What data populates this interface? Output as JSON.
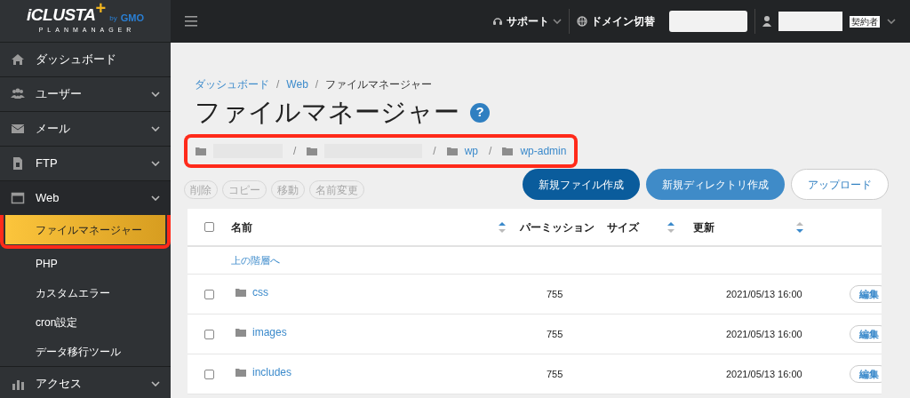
{
  "logo": {
    "brand": "iCLUSTA",
    "plus": "+",
    "by": "by",
    "maker": "GMO",
    "product": "PLANMANAGER"
  },
  "sidebar": {
    "items": [
      {
        "label": "ダッシュボード",
        "expandable": false,
        "highlighted": false
      },
      {
        "label": "ユーザー",
        "expandable": true,
        "highlighted": false
      },
      {
        "label": "メール",
        "expandable": true,
        "highlighted": false
      },
      {
        "label": "FTP",
        "expandable": true,
        "highlighted": false
      },
      {
        "label": "Web",
        "expandable": true,
        "expanded": true,
        "highlighted": true,
        "children": [
          {
            "label": "ファイルマネージャー",
            "selected": true
          },
          {
            "label": "PHP",
            "selected": false
          },
          {
            "label": "カスタムエラー",
            "selected": false
          },
          {
            "label": "cron設定",
            "selected": false
          },
          {
            "label": "データ移行ツール",
            "selected": false
          }
        ]
      },
      {
        "label": "アクセス",
        "expandable": true,
        "highlighted": false
      }
    ]
  },
  "top_bar": {
    "support": "サポート",
    "domain_switch": "ドメイン切替",
    "role_badge": "契約者"
  },
  "breadcrumb": {
    "separator": "/",
    "items": [
      {
        "label": "ダッシュボード",
        "link": true
      },
      {
        "label": "Web",
        "link": true
      },
      {
        "label": "ファイルマネージャー",
        "link": false
      }
    ]
  },
  "title": "ファイルマネージャー",
  "help_mark": "?",
  "path_bar": {
    "highlighted": true,
    "separator": "/",
    "segments": [
      {
        "kind": "redacted"
      },
      {
        "kind": "redacted"
      },
      {
        "kind": "folder",
        "label": "wp"
      },
      {
        "kind": "folder",
        "label": "wp-admin"
      }
    ]
  },
  "bulk_actions": [
    {
      "label": "削除",
      "disabled": true
    },
    {
      "label": "コピー",
      "disabled": true
    },
    {
      "label": "移動",
      "disabled": true
    },
    {
      "label": "名前変更",
      "disabled": true
    }
  ],
  "create_buttons": [
    {
      "label": "新規ファイル作成",
      "kind": "dark"
    },
    {
      "label": "新規ディレクトリ作成",
      "kind": "light"
    },
    {
      "label": "アップロード",
      "kind": "outline"
    }
  ],
  "table": {
    "columns": [
      {
        "label": "名前",
        "sortable": true,
        "sort_ascending": true
      },
      {
        "label": "パーミッション",
        "sortable": false
      },
      {
        "label": "サイズ",
        "sortable": true,
        "sort_ascending": true
      },
      {
        "label": "更新",
        "sortable": true,
        "sort_ascending": false
      }
    ],
    "all_checked": false,
    "parent_link": "上の階層へ",
    "rows": [
      {
        "name": "css",
        "permission": "755",
        "updated": "2021/05/13 16:00",
        "action": "編集",
        "checked": false
      },
      {
        "name": "images",
        "permission": "755",
        "updated": "2021/05/13 16:00",
        "action": "編集",
        "checked": false
      },
      {
        "name": "includes",
        "permission": "755",
        "updated": "2021/05/13 16:00",
        "action": "編集",
        "checked": false
      }
    ]
  }
}
